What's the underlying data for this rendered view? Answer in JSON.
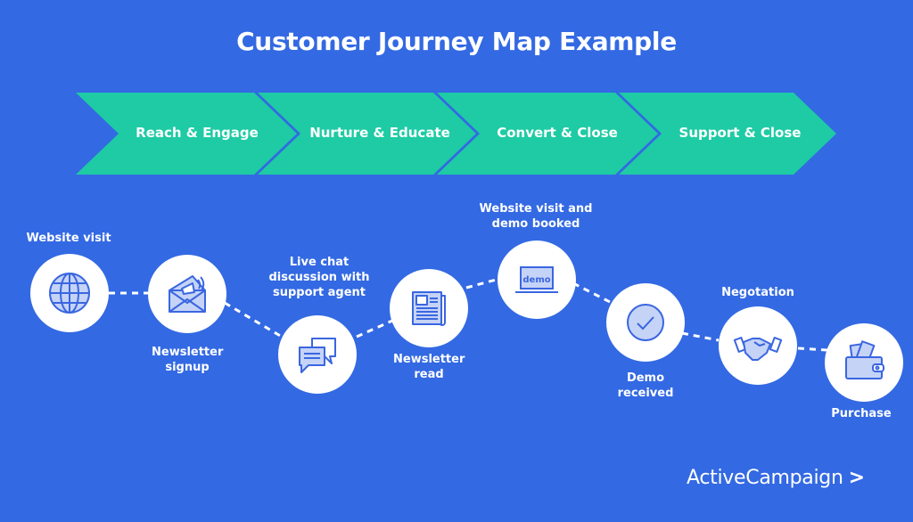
{
  "title": "Customer Journey Map Example",
  "colors": {
    "background": "#3369e3",
    "stage_fill": "#1ecba4",
    "icon_stroke": "#3a66e0",
    "icon_fill": "#c5d3f7"
  },
  "stages": [
    {
      "label": "Reach & Engage"
    },
    {
      "label": "Nurture & Educate"
    },
    {
      "label": "Convert & Close"
    },
    {
      "label": "Support & Close"
    }
  ],
  "touchpoints": [
    {
      "label": "Website visit",
      "icon": "globe-icon"
    },
    {
      "label": "Newsletter signup",
      "icon": "envelope-megaphone-icon"
    },
    {
      "label": "Live chat discussion with support agent",
      "icon": "chat-bubbles-icon"
    },
    {
      "label": "Newsletter read",
      "icon": "newspaper-icon"
    },
    {
      "label": "Website visit and demo booked",
      "icon": "laptop-demo-icon",
      "icon_text": "demo"
    },
    {
      "label": "Demo received",
      "icon": "checkmark-circle-icon"
    },
    {
      "label": "Negotation",
      "icon": "handshake-icon"
    },
    {
      "label": "Purchase",
      "icon": "wallet-icon"
    }
  ],
  "brand": {
    "name": "ActiveCampaign",
    "mark": ">"
  }
}
